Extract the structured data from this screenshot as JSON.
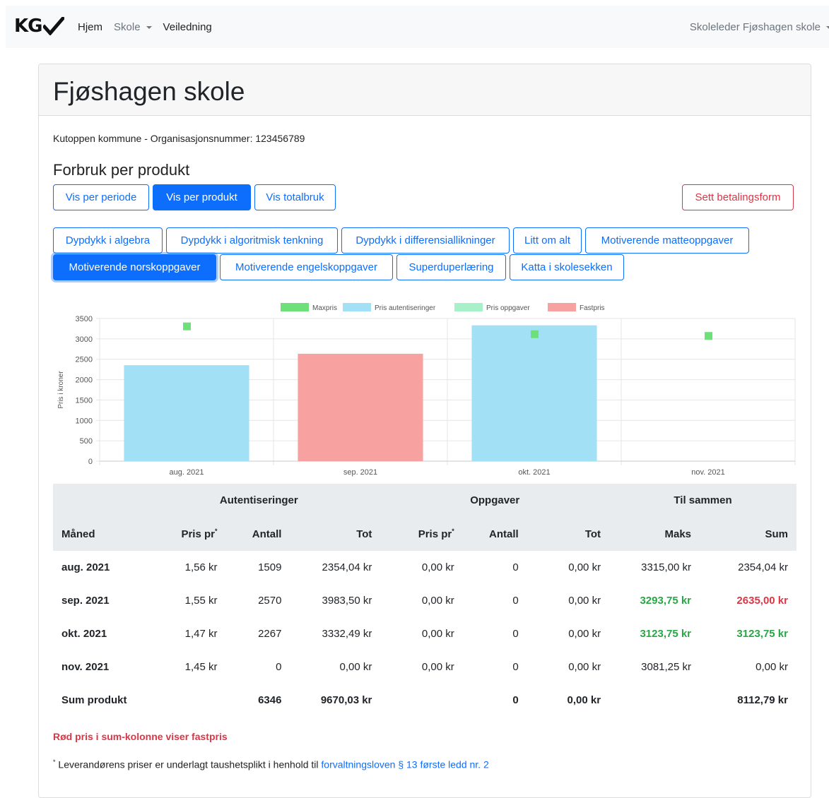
{
  "navbar": {
    "brand": "KG",
    "links": [
      "Hjem",
      "Skole",
      "Veiledning"
    ],
    "user_menu": "Skoleleder Fjøshagen skole"
  },
  "page": {
    "title": "Fjøshagen skole",
    "subtitle": "Kutoppen kommune - Organisasjonsnummer: 123456789",
    "section_title": "Forbruk per produkt"
  },
  "view_buttons": {
    "per_period": "Vis per periode",
    "per_product": "Vis per produkt",
    "total": "Vis totalbruk",
    "payment": "Sett betalingsform"
  },
  "products": [
    "Dypdykk i algebra",
    "Dypdykk i algoritmisk tenkning",
    "Dypdykk i differensiallikninger",
    "Litt om alt",
    "Motiverende matteoppgaver",
    "Motiverende norskoppgaver",
    "Motiverende engelskoppgaver",
    "Superduperlæring",
    "Katta i skolesekken"
  ],
  "selected_product": "Motiverende norskoppgaver",
  "colors": {
    "primary": "#0d6efd",
    "danger": "#dc3545",
    "success": "#28a745",
    "maxpris": "#6ee07a",
    "pris_autentiseringer": "#a2e0f6",
    "pris_oppgaver": "#a8f0c8",
    "fastpris": "#f7a1a1"
  },
  "chart_data": {
    "type": "bar",
    "categories": [
      "aug. 2021",
      "sep. 2021",
      "okt. 2021",
      "nov. 2021"
    ],
    "series": [
      {
        "name": "Maxpris",
        "type": "point",
        "values": [
          3315,
          null,
          3123.75,
          3081.25
        ]
      },
      {
        "name": "Pris autentiseringer",
        "type": "bar",
        "values": [
          2354.04,
          null,
          3332.49,
          null
        ]
      },
      {
        "name": "Pris oppgaver",
        "type": "bar",
        "values": [
          0,
          null,
          0,
          0
        ]
      },
      {
        "name": "Fastpris",
        "type": "bar",
        "values": [
          null,
          2635,
          null,
          null
        ]
      }
    ],
    "ylabel": "Pris i kroner",
    "ylim": [
      0,
      3500
    ],
    "yticks": [
      "3500",
      "3000",
      "2500",
      "2000",
      "1500",
      "1000",
      "500",
      "0"
    ],
    "legend": "top",
    "grid": true
  },
  "table": {
    "group_headers": [
      "Autentiseringer",
      "Oppgaver",
      "Til sammen"
    ],
    "columns": [
      "Måned",
      "Pris pr",
      "Antall",
      "Tot",
      "Pris pr",
      "Antall",
      "Tot",
      "Maks",
      "Sum"
    ],
    "footnote_marker": "*",
    "rows": [
      [
        "aug. 2021",
        "1,56 kr",
        "1509",
        "2354,04 kr",
        "0,00 kr",
        "0",
        "0,00 kr",
        "3315,00 kr",
        "2354,04 kr"
      ],
      [
        "sep. 2021",
        "1,55 kr",
        "2570",
        "3983,50 kr",
        "0,00 kr",
        "0",
        "0,00 kr",
        "3293,75 kr",
        "2635,00 kr"
      ],
      [
        "okt. 2021",
        "1,47 kr",
        "2267",
        "3332,49 kr",
        "0,00 kr",
        "0",
        "0,00 kr",
        "3123,75 kr",
        "3123,75 kr"
      ],
      [
        "nov. 2021",
        "1,45 kr",
        "0",
        "0,00 kr",
        "0,00 kr",
        "0",
        "0,00 kr",
        "3081,25 kr",
        "0,00 kr"
      ]
    ],
    "total": [
      "Sum produkt",
      "",
      "6346",
      "9670,03 kr",
      "",
      "0",
      "0,00 kr",
      "",
      "8112,79 kr"
    ]
  },
  "notes": {
    "red_note": "Rød pris i sum-kolonne viser fastpris",
    "footnote_marker": "*",
    "footnote_text": " Leverandørens priser er underlagt taushetsplikt i henhold til ",
    "footnote_link": "forvaltningsloven § 13 første ledd nr. 2"
  }
}
